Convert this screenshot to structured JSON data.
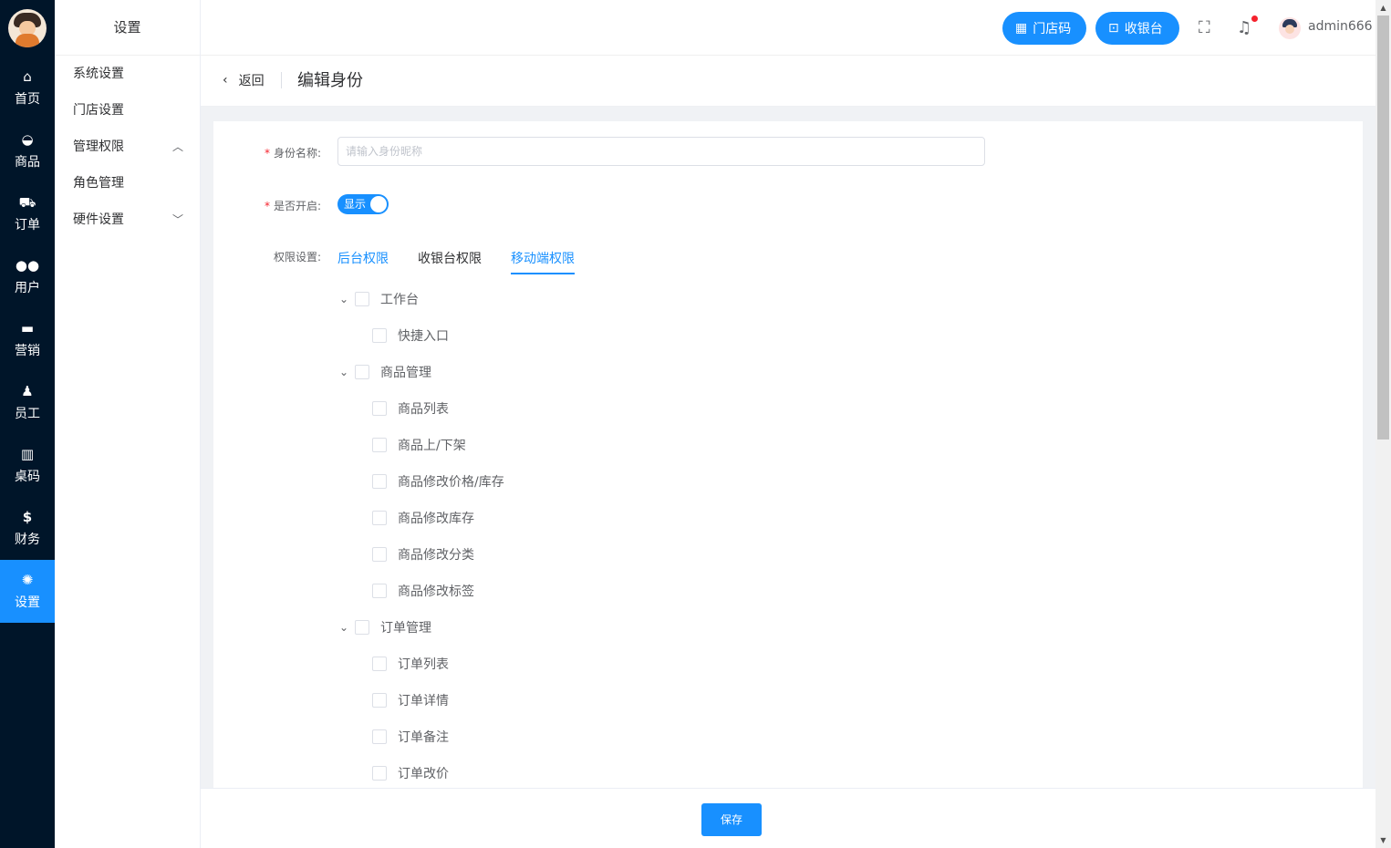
{
  "rail": {
    "items": [
      {
        "label": "首页",
        "icon": "⌂"
      },
      {
        "label": "商品",
        "icon": "🧺"
      },
      {
        "label": "订单",
        "icon": "🛒"
      },
      {
        "label": "用户",
        "icon": "👥"
      },
      {
        "label": "营销",
        "icon": "▬"
      },
      {
        "label": "员工",
        "icon": "👤"
      },
      {
        "label": "桌码",
        "icon": "▥"
      },
      {
        "label": "财务",
        "icon": "$"
      },
      {
        "label": "设置",
        "icon": "✺"
      }
    ]
  },
  "submenu": {
    "title": "设置",
    "items": [
      "系统设置",
      "门店设置",
      "管理权限",
      "角色管理",
      "硬件设置"
    ]
  },
  "header": {
    "store_code_label": "门店码",
    "cashier_label": "收银台",
    "username": "admin666"
  },
  "crumb": {
    "back_label": "返回",
    "page_title": "编辑身份"
  },
  "form": {
    "name_label": "身份名称:",
    "name_placeholder": "请输入身份昵称",
    "enabled_label": "是否开启:",
    "switch_text": "显示",
    "perm_label": "权限设置:",
    "tabs": [
      "后台权限",
      "收银台权限",
      "移动端权限"
    ]
  },
  "tree": {
    "g1": "工作台",
    "g1_items": [
      "快捷入口"
    ],
    "g2": "商品管理",
    "g2_items": [
      "商品列表",
      "商品上/下架",
      "商品修改价格/库存",
      "商品修改库存",
      "商品修改分类",
      "商品修改标签"
    ],
    "g3": "订单管理",
    "g3_items": [
      "订单列表",
      "订单详情",
      "订单备注",
      "订单改价"
    ]
  },
  "footer": {
    "save_label": "保存"
  },
  "colors": {
    "primary": "#1890ff",
    "rail_bg": "#001529"
  }
}
